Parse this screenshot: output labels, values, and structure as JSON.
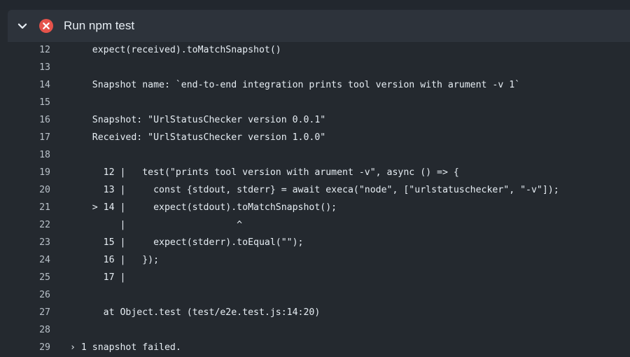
{
  "step": {
    "title": "Run npm test",
    "status": "failed",
    "status_color": "#e5534b",
    "icons": [
      "chevron-down-icon",
      "x-circle-icon"
    ]
  },
  "log": {
    "lines": [
      {
        "num": "12",
        "text": "    expect(received).toMatchSnapshot()"
      },
      {
        "num": "13",
        "text": ""
      },
      {
        "num": "14",
        "text": "    Snapshot name: `end-to-end integration prints tool version with arument -v 1`"
      },
      {
        "num": "15",
        "text": ""
      },
      {
        "num": "16",
        "text": "    Snapshot: \"UrlStatusChecker version 0.0.1\""
      },
      {
        "num": "17",
        "text": "    Received: \"UrlStatusChecker version 1.0.0\""
      },
      {
        "num": "18",
        "text": ""
      },
      {
        "num": "19",
        "text": "      12 |   test(\"prints tool version with arument -v\", async () => {"
      },
      {
        "num": "20",
        "text": "      13 |     const {stdout, stderr} = await execa(\"node\", [\"urlstatuschecker\", \"-v\"]);"
      },
      {
        "num": "21",
        "text": "    > 14 |     expect(stdout).toMatchSnapshot();"
      },
      {
        "num": "22",
        "text": "         |                    ^"
      },
      {
        "num": "23",
        "text": "      15 |     expect(stderr).toEqual(\"\");"
      },
      {
        "num": "24",
        "text": "      16 |   });"
      },
      {
        "num": "25",
        "text": "      17 |"
      },
      {
        "num": "26",
        "text": ""
      },
      {
        "num": "27",
        "text": "      at Object.test (test/e2e.test.js:14:20)"
      },
      {
        "num": "28",
        "text": ""
      },
      {
        "num": "29",
        "text": "› 1 snapshot failed."
      }
    ]
  }
}
